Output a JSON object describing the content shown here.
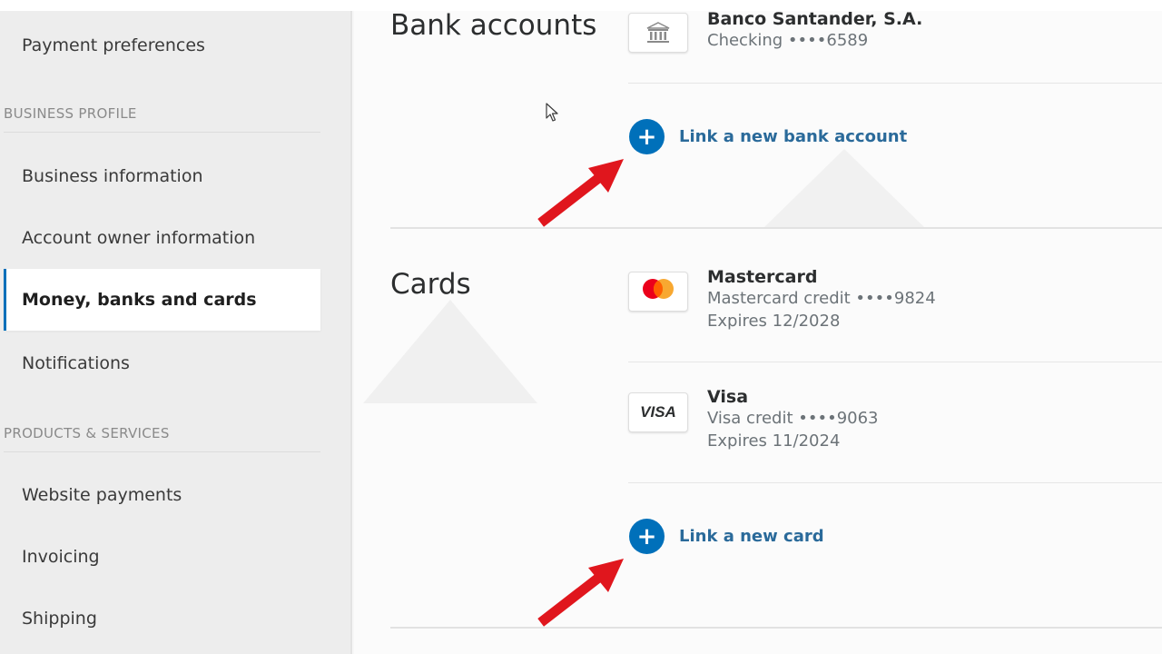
{
  "sidebar": {
    "items_top": [
      {
        "label": "Payment preferences"
      }
    ],
    "business_profile": {
      "header": "BUSINESS PROFILE",
      "items": [
        {
          "label": "Business information"
        },
        {
          "label": "Account owner information"
        },
        {
          "label": "Money, banks and cards"
        },
        {
          "label": "Notifications"
        }
      ]
    },
    "products_services": {
      "header": "PRODUCTS & SERVICES",
      "items": [
        {
          "label": "Website payments"
        },
        {
          "label": "Invoicing"
        },
        {
          "label": "Shipping"
        }
      ]
    }
  },
  "bank_accounts": {
    "title": "Bank accounts",
    "items": [
      {
        "name": "Banco Santander, S.A.",
        "detail": "Checking ••••6589"
      }
    ],
    "link_label": "Link a new bank account"
  },
  "cards": {
    "title": "Cards",
    "items": [
      {
        "brand_mark": "mastercard",
        "name": "Mastercard",
        "detail": "Mastercard credit ••••9824",
        "expires": "Expires 12/2028"
      },
      {
        "brand_mark": "VISA",
        "name": "Visa",
        "detail": "Visa credit ••••9063",
        "expires": "Expires 11/2024"
      }
    ],
    "link_label": "Link a new card"
  },
  "icons": {
    "bank": "bank-icon",
    "plus": "plus-icon",
    "arrow": "red-arrow-annotation",
    "cursor": "mouse-pointer-icon"
  },
  "colors": {
    "accent": "#0070ba",
    "link_text": "#2a6a9a",
    "arrow": "#e0161d",
    "mastercard_red": "#eb001b",
    "mastercard_orange": "#f79e1b"
  }
}
